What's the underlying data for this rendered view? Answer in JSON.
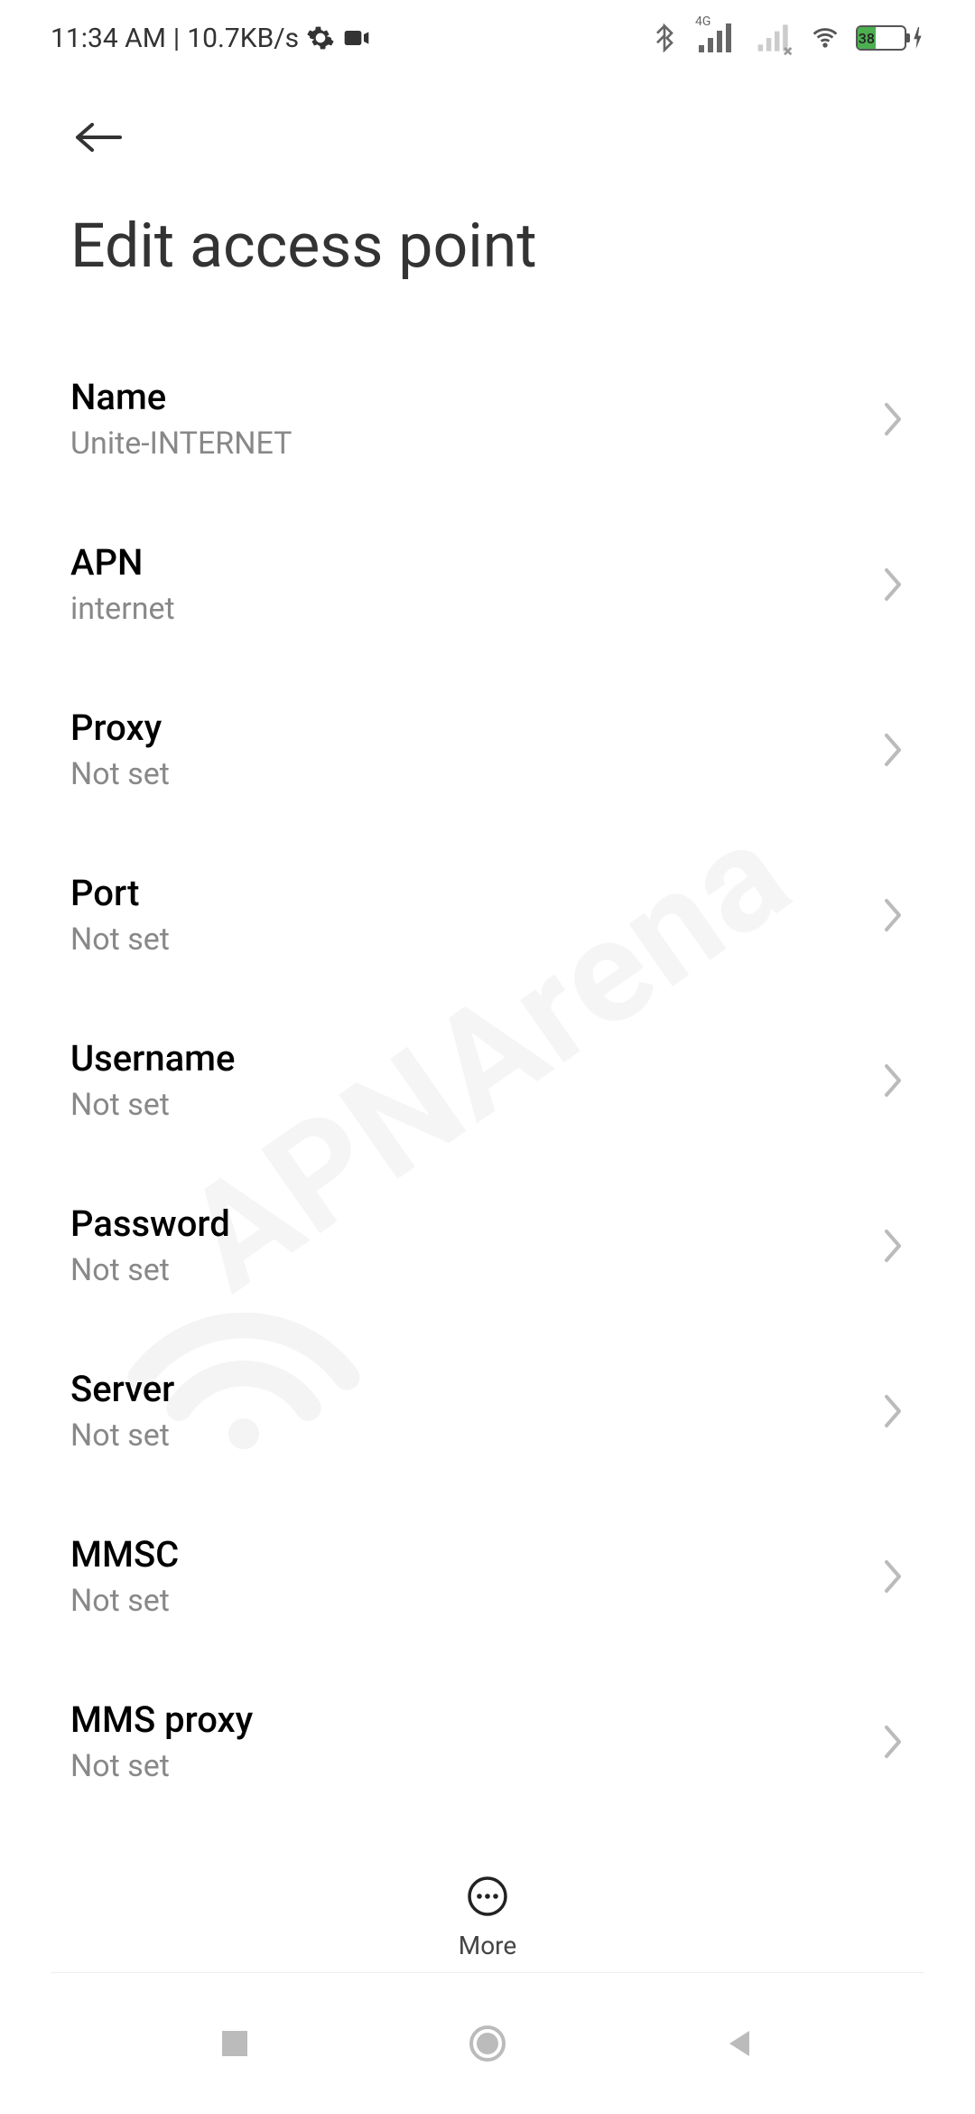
{
  "status_bar": {
    "time": "11:34 AM",
    "data_rate": "10.7KB/s",
    "battery_percent": "38",
    "network_type": "4G"
  },
  "page": {
    "title": "Edit access point"
  },
  "settings": [
    {
      "label": "Name",
      "value": "Unite-INTERNET"
    },
    {
      "label": "APN",
      "value": "internet"
    },
    {
      "label": "Proxy",
      "value": "Not set"
    },
    {
      "label": "Port",
      "value": "Not set"
    },
    {
      "label": "Username",
      "value": "Not set"
    },
    {
      "label": "Password",
      "value": "Not set"
    },
    {
      "label": "Server",
      "value": "Not set"
    },
    {
      "label": "MMSC",
      "value": "Not set"
    },
    {
      "label": "MMS proxy",
      "value": "Not set"
    }
  ],
  "bottom_action": {
    "label": "More"
  },
  "watermark": "APNArena"
}
